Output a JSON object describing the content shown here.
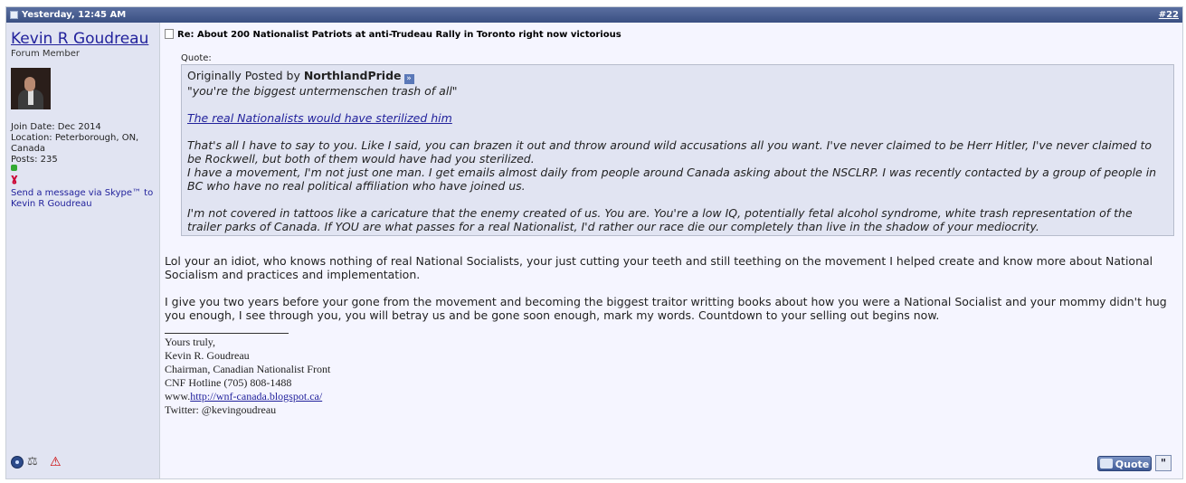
{
  "header": {
    "date": "Yesterday, 12:45 AM",
    "post_number": "#22"
  },
  "user": {
    "name": "Kevin R Goudreau",
    "title": "Forum Member",
    "join_date": "Join Date: Dec 2014",
    "location_line1": "Location: Peterborough, ON,",
    "location_line2": "Canada",
    "posts": "Posts: 235",
    "skype_link": "Send a message via Skype™ to Kevin R Goudreau"
  },
  "post": {
    "title": "Re: About 200 Nationalist Patriots at anti-Trudeau Rally in Toronto right now victorious",
    "quote_label": "Quote:",
    "quote": {
      "originally_posted_by": "Originally Posted by",
      "author": "NorthlandPride",
      "line1": "\"you're the biggest untermenschen trash of all\"",
      "link": "The real Nationalists would have sterilized him",
      "para2": "That's all I have to say to you. Like I said, you can brazen it out and throw around wild accusations all you want. I've never claimed to be Herr Hitler, I've never claimed to be Rockwell, but both of them would have had you sterilized.",
      "para3": "I have a movement, I'm not just one man. I get emails almost daily from people around Canada asking about the NSCLRP. I was recently contacted by a group of people in BC who have no real political affiliation who have joined us.",
      "para4": "I'm not covered in tattoos like a caricature that the enemy created of us. You are. You're a low IQ, potentially fetal alcohol syndrome, white trash representation of the trailer parks of Canada. If YOU are what passes for a real Nationalist, I'd rather our race die our completely than live in the shadow of your mediocrity."
    },
    "body1": "Lol your an idiot, who knows nothing of real National Socialists, your just cutting your teeth and still teething on the movement I helped create and know more about National Socialism and practices and implementation.",
    "body2": "I give you two years before your gone from the movement and becoming the biggest traitor writting books about how you were a National Socialist and your mommy didn't hug you enough, I see through you, you will betray us and be gone soon enough, mark my words. Countdown to your selling out begins now."
  },
  "signature": {
    "line1": "Yours truly,",
    "line2": "Kevin R. Goudreau",
    "line3": "Chairman, Canadian Nationalist Front",
    "line4": "CNF Hotline (705) 808-1488",
    "www_prefix": "www.",
    "url": "http://wnf-canada.blogspot.ca/",
    "twitter": "Twitter: @kevingoudreau"
  },
  "buttons": {
    "quote": "Quote",
    "multiquote": "\""
  },
  "icons": {
    "header": "post-doc-icon",
    "online": "online-status-icon",
    "reputation": "reputation-icon",
    "report": "report-icon",
    "view_ip": "view-ip-icon",
    "scale": "reputation-scale-icon"
  }
}
